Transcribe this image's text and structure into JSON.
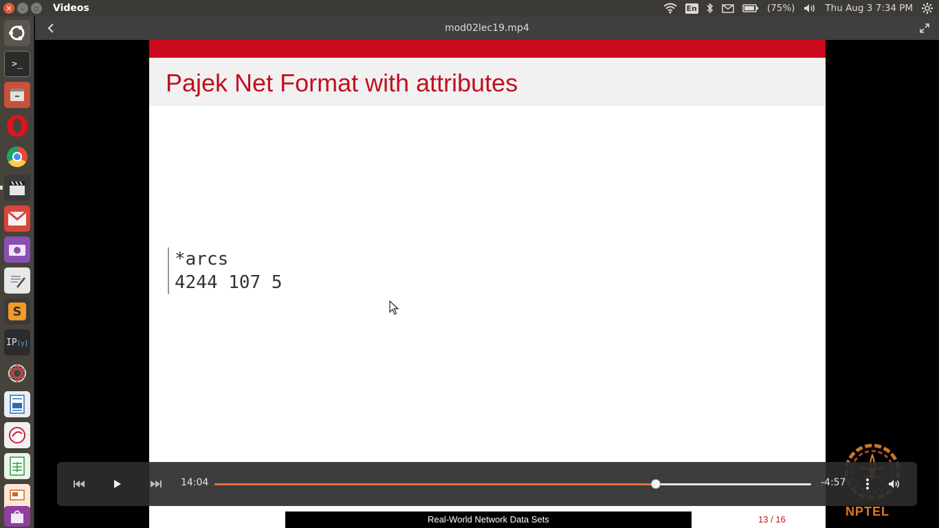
{
  "top_panel": {
    "app_title": "Videos",
    "lang": "En",
    "battery": "(75%)",
    "datetime": "Thu Aug  3  7:34 PM"
  },
  "video_window": {
    "title": "mod02lec19.mp4"
  },
  "launcher": {
    "items": [
      "dash-home",
      "terminal",
      "files",
      "opera",
      "chrome",
      "video-editor",
      "gmail",
      "photo-viewer",
      "text-editor",
      "sublime-text",
      "ipython",
      "network-tool",
      "writer",
      "evince",
      "calc",
      "impress",
      "software-center"
    ]
  },
  "slide": {
    "title": "Pajek Net Format with attributes",
    "code_lines": [
      "*arcs",
      "4244 107 5"
    ],
    "footer": "Real-World Network Data Sets",
    "page": "13 / 16"
  },
  "logo": {
    "text": "NPTEL"
  },
  "player": {
    "elapsed": "14:04",
    "remaining": "-4:57",
    "progress": 0.74,
    "accent": "#e8703a"
  }
}
